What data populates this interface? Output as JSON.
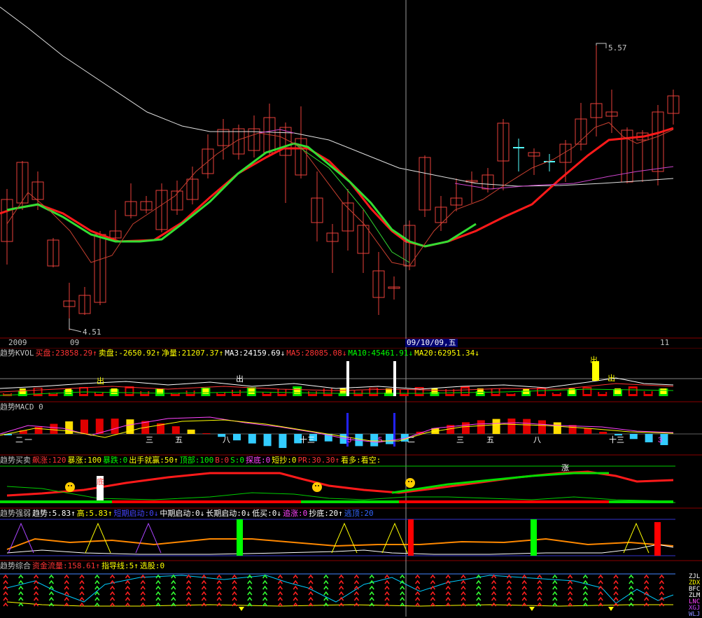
{
  "colors": {
    "up": "#e8403a",
    "down": "#54ffff",
    "ma_red": "#ff1a1a",
    "ma_green": "#33dd33",
    "ma_white": "#e0e0e0",
    "ma_magenta": "#cc44cc",
    "ma_thin_red": "#c84030",
    "grid": "#8a0000",
    "cursor": "#9a9a9a",
    "yellow": "#ffff00",
    "green": "#00ff00"
  },
  "price_labels": {
    "high": "5.57",
    "low": "4.51"
  },
  "date_axis": {
    "year": "2009",
    "m09": "09",
    "cursor_date": "09/10/09,五",
    "m11": "11"
  },
  "panels": {
    "kvol": {
      "title": "趋势KVOL",
      "items": [
        {
          "text": "买盘:23858.29↑",
          "color": "#ff3333"
        },
        {
          "text": "卖盘:-2650.92↑",
          "color": "#ffff00"
        },
        {
          "text": "净量:21207.37↑",
          "color": "#ffff00"
        },
        {
          "text": "MA3:24159.69↓",
          "color": "#ffffff"
        },
        {
          "text": "MA5:28085.08↓",
          "color": "#ff3333"
        },
        {
          "text": "MA10:45461.91↓",
          "color": "#00ff00"
        },
        {
          "text": "MA20:62951.34↓",
          "color": "#ffff00"
        }
      ],
      "marks": [
        "出",
        "出",
        "出",
        "出"
      ]
    },
    "macd": {
      "title": "趋势MACD 0",
      "labels": [
        "二",
        "一",
        "三",
        "五",
        "八",
        "十三",
        "3",
        "5",
        "二",
        "三",
        "五",
        "八",
        "十三",
        "3"
      ]
    },
    "buysell": {
      "title": "趋势买卖",
      "items": [
        {
          "text": "飙涨:120",
          "color": "#ff3333"
        },
        {
          "text": "暴涨:100",
          "color": "#ffff00"
        },
        {
          "text": "暴跌:0",
          "color": "#00ff00"
        },
        {
          "text": "出手就赢:50↑",
          "color": "#ffff00"
        },
        {
          "text": "顶部:100",
          "color": "#00ff00"
        },
        {
          "text": "B:0",
          "color": "#ff3333"
        },
        {
          "text": "S:0",
          "color": "#00ff00"
        },
        {
          "text": "探底:0",
          "color": "#ff44ff"
        },
        {
          "text": "短抄:0",
          "color": "#ffff00"
        },
        {
          "text": "PR:30.30↑",
          "color": "#ff3333"
        },
        {
          "text": "看多:看空:",
          "color": "#ffff00"
        }
      ],
      "marks": [
        "底",
        "涨"
      ]
    },
    "strength": {
      "title": "趋势强弱",
      "items": [
        {
          "text": "趋势:5.83↑",
          "color": "#ffffff"
        },
        {
          "text": "高:5.83↑",
          "color": "#ffff00"
        },
        {
          "text": "短期启动:0↓",
          "color": "#4444ff"
        },
        {
          "text": "中期启动:0↓",
          "color": "#ffffff"
        },
        {
          "text": "长期启动:0↓",
          "color": "#ffffff"
        },
        {
          "text": "低买:0↓",
          "color": "#ffffff"
        },
        {
          "text": "追涨:0",
          "color": "#ff44ff"
        },
        {
          "text": "抄底:20↑",
          "color": "#ffffff"
        },
        {
          "text": "逃顶:20",
          "color": "#3366ff"
        }
      ]
    },
    "composite": {
      "title": "趋势综合",
      "items": [
        {
          "text": "资金流量:158.61↑",
          "color": "#ff3333"
        },
        {
          "text": "指导线:5↑",
          "color": "#ffff00"
        },
        {
          "text": "选股:0",
          "color": "#ffff00"
        }
      ],
      "side_labels": [
        "ZJL",
        "ZDX",
        "BFC",
        "ZLM",
        "LNC",
        "XGJ",
        "WLJ"
      ]
    }
  }
}
